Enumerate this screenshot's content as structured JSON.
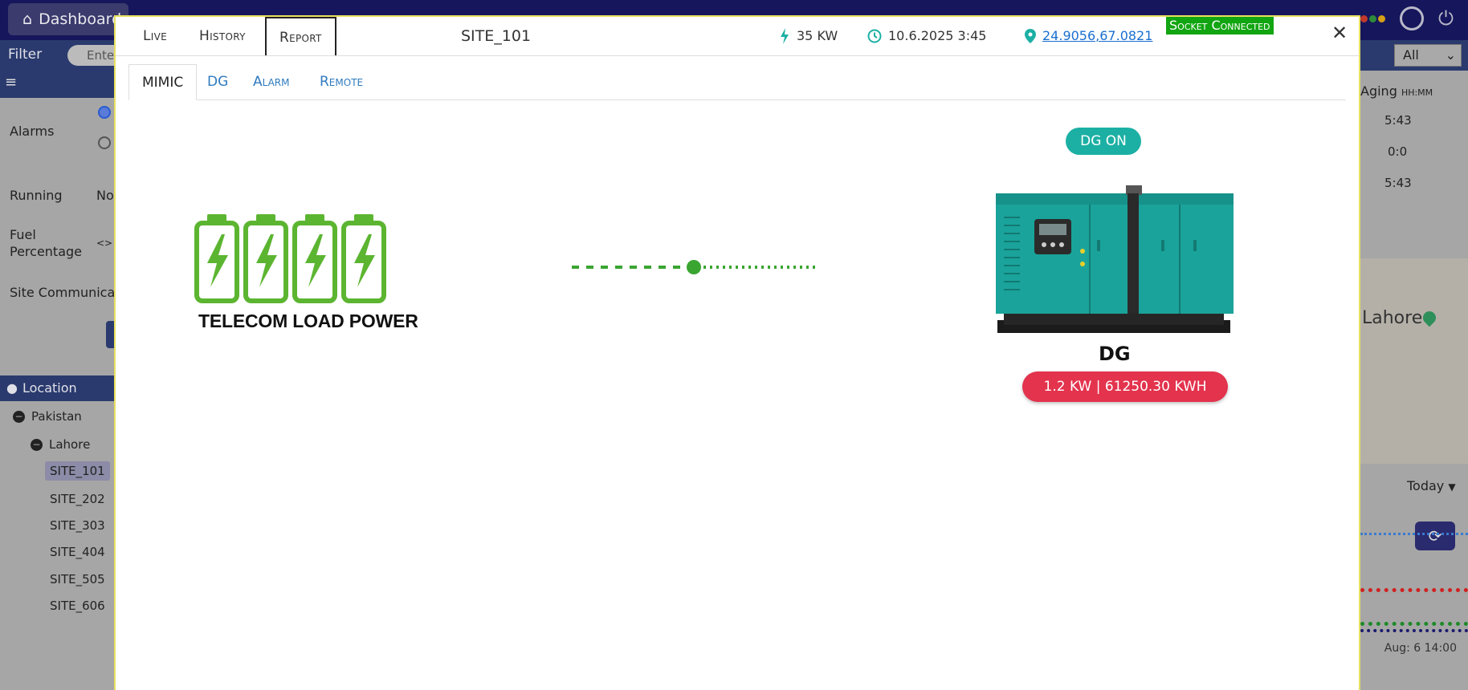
{
  "app": {
    "dashboard_label": "Dashboard",
    "filter_label": "Filter",
    "search_placeholder": "Ente",
    "all_select": "All",
    "left": {
      "alarms_label": "Alarms",
      "running_label": "Running",
      "running_value": "No",
      "fuel_label": "Fuel Percentage",
      "fuel_value": "<>",
      "site_comm_label": "Site Communicati",
      "location_label": "Location",
      "country": "Pakistan",
      "city": "Lahore",
      "sites": [
        "SITE_101",
        "SITE_202",
        "SITE_303",
        "SITE_404",
        "SITE_505",
        "SITE_606"
      ]
    },
    "right": {
      "aging_label": "Aging",
      "aging_unit": "HH:MM",
      "aging_values": [
        "5:43",
        "0:0",
        "5:43"
      ],
      "map_label": "Lahore",
      "today_label": "Today",
      "time_label": "Aug: 6 14:00"
    }
  },
  "modal": {
    "tabs": [
      "Live",
      "History",
      "Report"
    ],
    "active_tab": "Report",
    "site_title": "SITE_101",
    "power": "35 KW",
    "datetime": "10.6.2025 3:45",
    "coordinates": "24.9056,67.0821",
    "socket_status": "Socket Connected",
    "close_symbol": "✕",
    "subtabs": [
      "MIMIC",
      "DG",
      "Alarm",
      "Remote"
    ],
    "active_subtab": "MIMIC",
    "mimic": {
      "load_label": "TELECOM LOAD POWER",
      "dg_status": "DG ON",
      "dg_label": "DG",
      "dg_reading": "1.2 KW | 61250.30 KWH"
    }
  },
  "colors": {
    "battery_green": "#5cb531",
    "flow_green": "#3aa531",
    "dg_on_teal": "#1cb0a4",
    "badge_red": "#e3334d",
    "socket_green": "#12a512",
    "link_blue": "#1a6fd0",
    "generator_teal": "#1aa39a"
  }
}
